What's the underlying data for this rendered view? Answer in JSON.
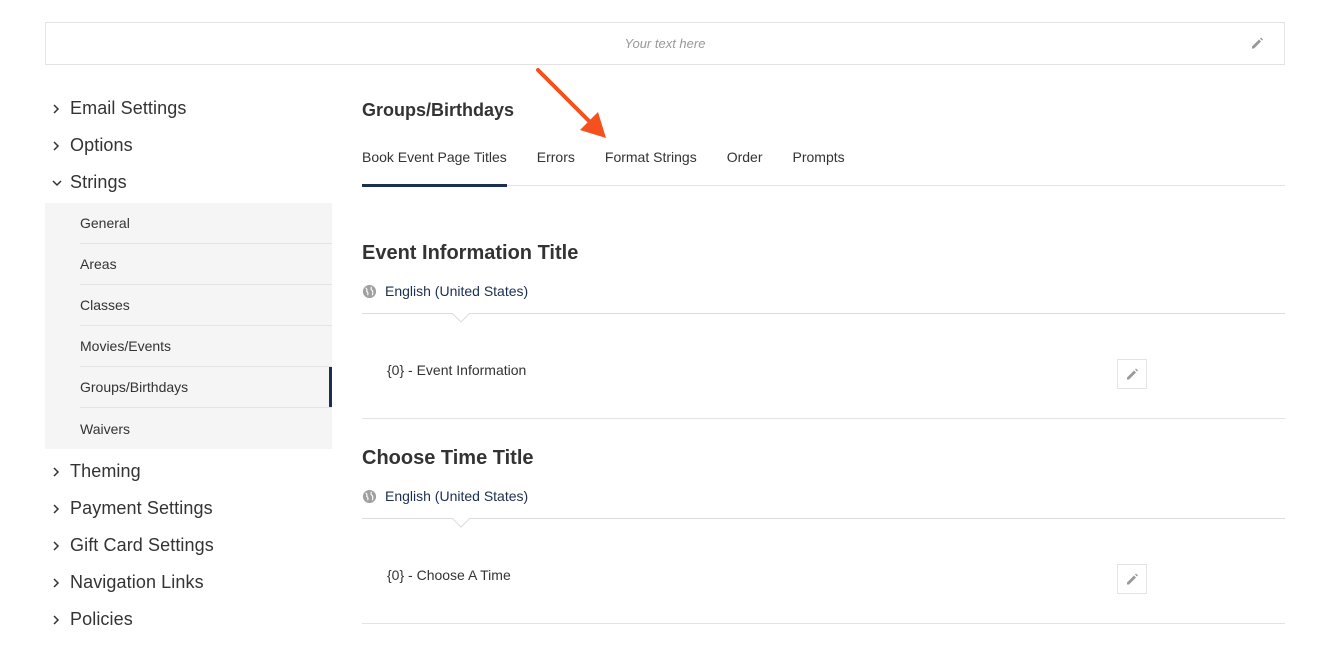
{
  "header": {
    "placeholder": "Your text here",
    "edit_icon": "pencil-icon"
  },
  "sidebar": {
    "items_top": [
      {
        "label": "Email Settings",
        "expanded": false
      },
      {
        "label": "Options",
        "expanded": false
      },
      {
        "label": "Strings",
        "expanded": true
      }
    ],
    "sub_items": [
      {
        "label": "General"
      },
      {
        "label": "Areas"
      },
      {
        "label": "Classes"
      },
      {
        "label": "Movies/Events"
      },
      {
        "label": "Groups/Birthdays",
        "active": true
      },
      {
        "label": "Waivers"
      }
    ],
    "items_bottom": [
      {
        "label": "Theming"
      },
      {
        "label": "Payment Settings"
      },
      {
        "label": "Gift Card Settings"
      },
      {
        "label": "Navigation Links"
      },
      {
        "label": "Policies"
      }
    ]
  },
  "main": {
    "section_title": "Groups/Birthdays",
    "tabs": [
      {
        "label": "Book Event Page Titles",
        "active": true
      },
      {
        "label": "Errors"
      },
      {
        "label": "Format Strings"
      },
      {
        "label": "Order"
      },
      {
        "label": "Prompts"
      }
    ],
    "blocks": [
      {
        "title": "Event Information Title",
        "language": "English (United States)",
        "value": "{0} - Event Information"
      },
      {
        "title": "Choose Time Title",
        "language": "English (United States)",
        "value": "{0} - Choose A Time"
      }
    ]
  },
  "colors": {
    "accent": "#1c2f4f",
    "annotation_arrow": "#f4511e"
  }
}
